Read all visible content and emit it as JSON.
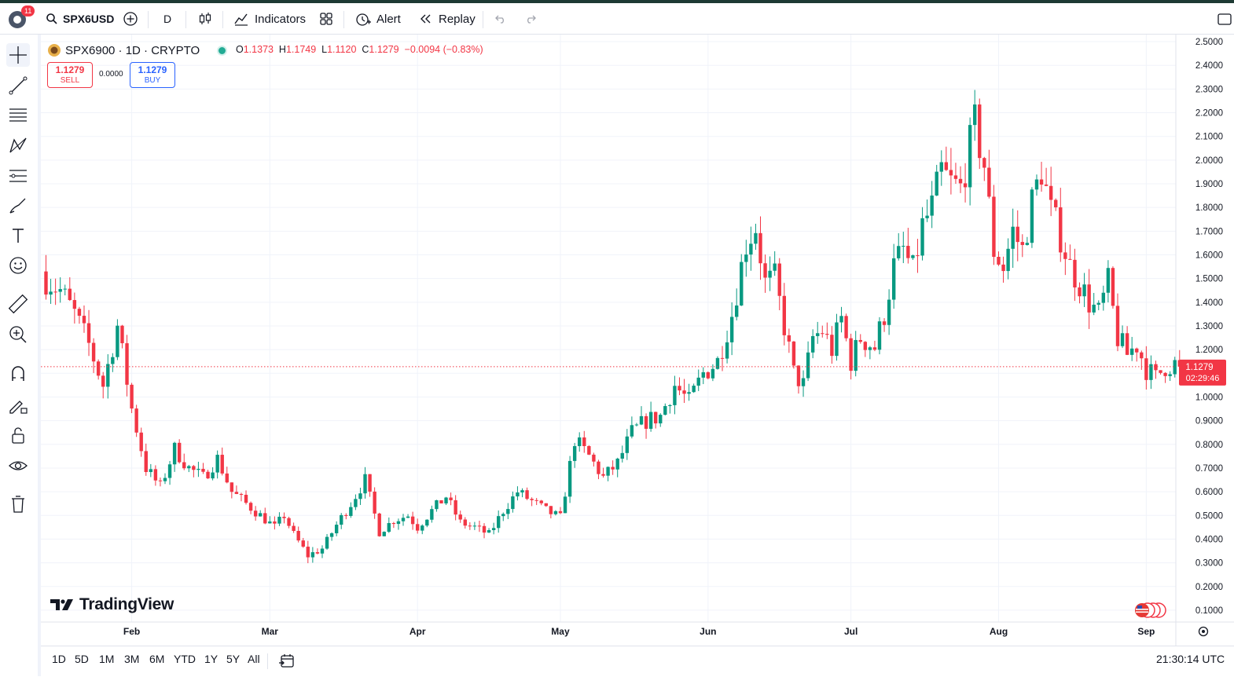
{
  "topbar": {
    "notification_count": "11",
    "symbol": "SPX6USD",
    "interval": "D",
    "indicators_label": "Indicators",
    "alert_label": "Alert",
    "replay_label": "Replay"
  },
  "legend": {
    "title": "SPX6900 · 1D · CRYPTO",
    "o_label": "O",
    "o_value": "1.1373",
    "h_label": "H",
    "h_value": "1.1749",
    "l_label": "L",
    "l_value": "1.1120",
    "c_label": "C",
    "c_value": "1.1279",
    "change": "−0.0094 (−0.83%)"
  },
  "trade": {
    "sell_price": "1.1279",
    "sell_label": "SELL",
    "spread": "0.0000",
    "buy_price": "1.1279",
    "buy_label": "BUY"
  },
  "price_tag": {
    "price": "1.1279",
    "countdown": "02:29:46"
  },
  "branding": {
    "logo_text": "TradingView"
  },
  "bottombar": {
    "ranges": [
      "1D",
      "5D",
      "1M",
      "3M",
      "6M",
      "YTD",
      "1Y",
      "5Y",
      "All"
    ],
    "time": "21:30:14 UTC"
  },
  "colors": {
    "up": "#089981",
    "down": "#f23645",
    "accent": "#2962ff"
  },
  "left_tools": [
    "crosshair-icon",
    "trendline-icon",
    "fib-icon",
    "pattern-icon",
    "forecast-icon",
    "brush-icon",
    "text-icon",
    "emoji-icon",
    "ruler-icon",
    "zoom-in-icon",
    "magnet-icon",
    "lock-draw-icon",
    "lock-icon",
    "eye-icon",
    "trash-icon"
  ],
  "chart_data": {
    "type": "candlestick",
    "ylim": [
      0.05,
      2.53
    ],
    "y_ticks": [
      "0.1000",
      "0.2000",
      "0.3000",
      "0.4000",
      "0.5000",
      "0.6000",
      "0.7000",
      "0.8000",
      "0.9000",
      "1.0000",
      "1.1000",
      "1.2000",
      "1.3000",
      "1.4000",
      "1.5000",
      "1.6000",
      "1.7000",
      "1.8000",
      "1.9000",
      "2.0000",
      "2.1000",
      "2.2000",
      "2.3000",
      "2.4000",
      "2.5000"
    ],
    "x_ticks": [
      {
        "label": "Feb",
        "day": 18
      },
      {
        "label": "Mar",
        "day": 47
      },
      {
        "label": "Apr",
        "day": 78
      },
      {
        "label": "May",
        "day": 108
      },
      {
        "label": "Jun",
        "day": 139
      },
      {
        "label": "Jul",
        "day": 169
      },
      {
        "label": "Aug",
        "day": 200
      },
      {
        "label": "Sep",
        "day": 231
      }
    ],
    "last_price": 1.1279,
    "anchors": [
      [
        0,
        1.5
      ],
      [
        3,
        1.45
      ],
      [
        6,
        1.35
      ],
      [
        9,
        1.22
      ],
      [
        12,
        1.05
      ],
      [
        15,
        1.3
      ],
      [
        18,
        0.95
      ],
      [
        21,
        0.7
      ],
      [
        24,
        0.62
      ],
      [
        27,
        0.78
      ],
      [
        30,
        0.7
      ],
      [
        33,
        0.66
      ],
      [
        36,
        0.74
      ],
      [
        39,
        0.6
      ],
      [
        42,
        0.55
      ],
      [
        45,
        0.5
      ],
      [
        48,
        0.45
      ],
      [
        50,
        0.5
      ],
      [
        52,
        0.42
      ],
      [
        55,
        0.33
      ],
      [
        58,
        0.36
      ],
      [
        61,
        0.46
      ],
      [
        64,
        0.55
      ],
      [
        67,
        0.65
      ],
      [
        70,
        0.43
      ],
      [
        73,
        0.48
      ],
      [
        76,
        0.5
      ],
      [
        78,
        0.45
      ],
      [
        81,
        0.52
      ],
      [
        84,
        0.58
      ],
      [
        87,
        0.47
      ],
      [
        90,
        0.45
      ],
      [
        93,
        0.42
      ],
      [
        96,
        0.52
      ],
      [
        99,
        0.6
      ],
      [
        102,
        0.56
      ],
      [
        105,
        0.52
      ],
      [
        108,
        0.49
      ],
      [
        111,
        0.82
      ],
      [
        114,
        0.75
      ],
      [
        117,
        0.66
      ],
      [
        120,
        0.72
      ],
      [
        123,
        0.85
      ],
      [
        126,
        0.9
      ],
      [
        129,
        0.92
      ],
      [
        132,
        1.05
      ],
      [
        135,
        0.98
      ],
      [
        138,
        1.1
      ],
      [
        141,
        1.15
      ],
      [
        144,
        1.35
      ],
      [
        147,
        1.65
      ],
      [
        149,
        1.72
      ],
      [
        151,
        1.48
      ],
      [
        153,
        1.5
      ],
      [
        155,
        1.3
      ],
      [
        157,
        1.1
      ],
      [
        159,
        1.05
      ],
      [
        161,
        1.25
      ],
      [
        163,
        1.28
      ],
      [
        165,
        1.2
      ],
      [
        167,
        1.33
      ],
      [
        169,
        1.15
      ],
      [
        171,
        1.25
      ],
      [
        174,
        1.21
      ],
      [
        176,
        1.35
      ],
      [
        178,
        1.55
      ],
      [
        180,
        1.62
      ],
      [
        182,
        1.53
      ],
      [
        184,
        1.72
      ],
      [
        186,
        1.8
      ],
      [
        188,
        1.95
      ],
      [
        190,
        1.9
      ],
      [
        192,
        1.88
      ],
      [
        195,
        2.15
      ],
      [
        197,
        1.98
      ],
      [
        199,
        1.62
      ],
      [
        201,
        1.55
      ],
      [
        203,
        1.7
      ],
      [
        205,
        1.62
      ],
      [
        207,
        1.82
      ],
      [
        209,
        1.96
      ],
      [
        211,
        1.78
      ],
      [
        213,
        1.68
      ],
      [
        215,
        1.55
      ],
      [
        217,
        1.48
      ],
      [
        219,
        1.4
      ],
      [
        221,
        1.35
      ],
      [
        223,
        1.48
      ],
      [
        225,
        1.25
      ],
      [
        227,
        1.18
      ],
      [
        229,
        1.22
      ],
      [
        231,
        1.12
      ],
      [
        233,
        1.08
      ],
      [
        235,
        1.13
      ],
      [
        237,
        1.14
      ],
      [
        238,
        1.1279
      ]
    ]
  }
}
